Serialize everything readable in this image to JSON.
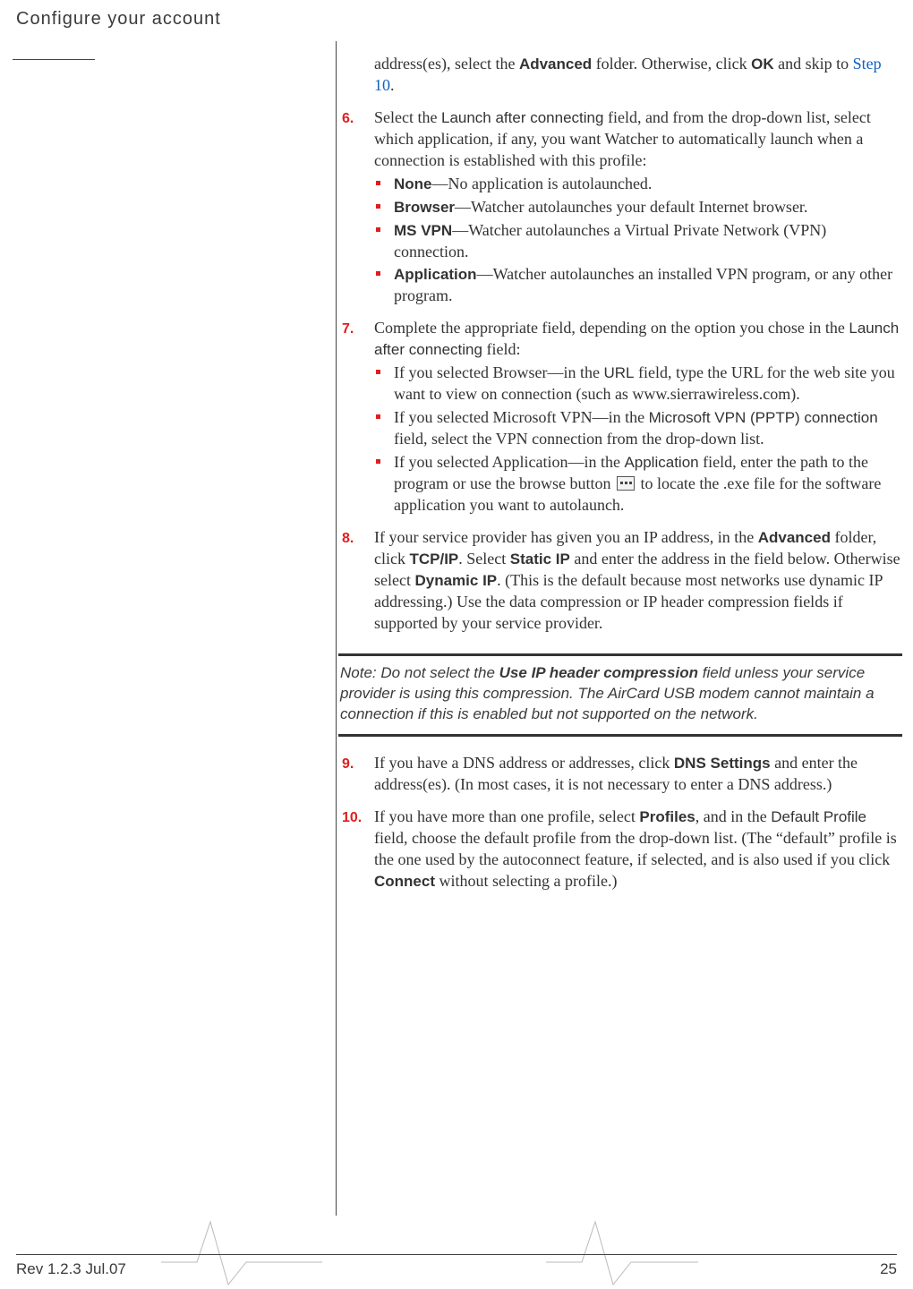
{
  "header": {
    "title": "Configure your account"
  },
  "intro": {
    "part1": "address(es), select the ",
    "advanced": "Advanced",
    "part2": " folder. Otherwise, click ",
    "ok": "OK",
    "part3": " and skip to ",
    "step10_link": "Step 10",
    "part4": "."
  },
  "step6": {
    "num": "6.",
    "p1a": "Select the ",
    "p1b": "Launch after connecting",
    "p1c": " field, and from the drop-down list, select which application, if any, you want Watcher to automatically launch when a connection is established with this profile:",
    "b1_bold": "None",
    "b1_text": "—No application is autolaunched.",
    "b2_bold": "Browser",
    "b2_text": "—Watcher autolaunches your default Internet browser.",
    "b3_bold": "MS VPN",
    "b3_text": "—Watcher autolaunches a Virtual Private Network (VPN) connection.",
    "b4_bold": "Application",
    "b4_text": "—Watcher autolaunches an installed VPN program, or any other program."
  },
  "step7": {
    "num": "7.",
    "p1a": "Complete the appropriate field, depending on the option you chose in the ",
    "p1b": "Launch after connecting",
    "p1c": " field:",
    "b1a": "If you selected Browser—in the ",
    "b1b": "URL",
    "b1c": " field, type the URL for the web site you want to view on connection (such as www.sierrawireless.com).",
    "b2a": "If you selected Microsoft VPN—in the ",
    "b2b": "Microsoft VPN (PPTP) connection",
    "b2c": " field, select the VPN connection from the drop-down list.",
    "b3a": "If you selected Application—in the ",
    "b3b": "Application",
    "b3c": " field, enter the path to the program or use the browse button ",
    "b3d": " to locate the .exe file for the software application you want to autolaunch."
  },
  "step8": {
    "num": "8.",
    "t1": "If your service provider has given you an IP address, in the ",
    "t2": "Advanced",
    "t3": " folder, click ",
    "t4": "TCP/IP",
    "t5": ". Select ",
    "t6": "Static IP",
    "t7": " and enter the address in the field below. Otherwise select ",
    "t8": "Dynamic IP",
    "t9": ". (This is the default because most networks use dynamic IP addressing.) Use the data compression or IP header compression fields if supported by your service provider."
  },
  "note": {
    "t1": "Note:  Do not select the ",
    "t2": "Use IP header compression",
    "t3": " field unless your service provider is using this compression. The AirCard USB modem cannot maintain a connection if this is enabled but not supported on the network."
  },
  "step9": {
    "num": "9.",
    "t1": "If you have a DNS address or addresses, click ",
    "t2": "DNS Settings",
    "t3": " and enter the address(es). (In most cases, it is not necessary to enter a DNS address.)"
  },
  "step10": {
    "num": "10.",
    "t1": "If you have more than one profile, select ",
    "t2": "Profiles",
    "t3": ", and in the ",
    "t4": "Default Profile",
    "t5": " field, choose the default profile from the drop-down list. (The “default” profile is the one used by the autoconnect feature, if selected, and is also used if you click ",
    "t6": "Connect",
    "t7": " without selecting a profile.)"
  },
  "footer": {
    "rev": "Rev 1.2.3 Jul.07",
    "page": "25"
  }
}
